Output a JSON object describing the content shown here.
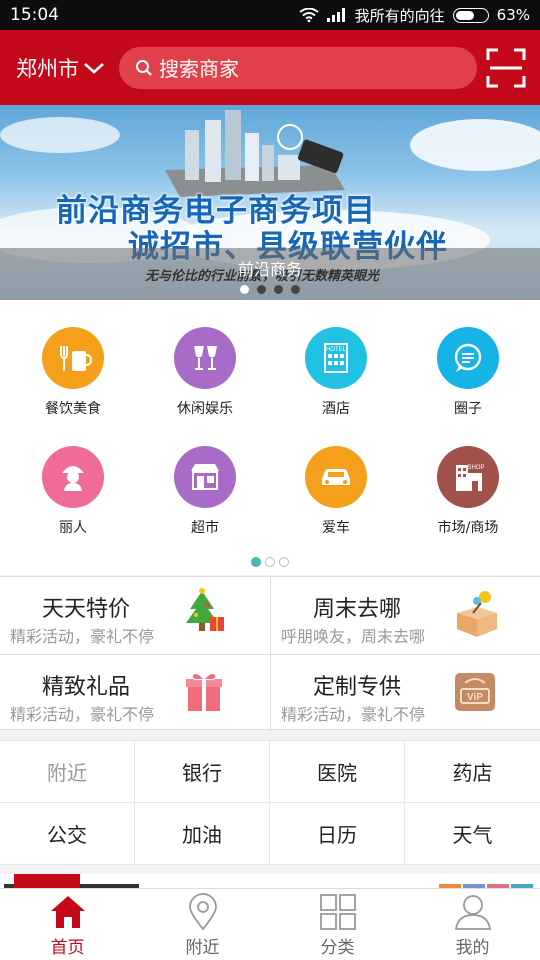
{
  "status_bar": {
    "time": "15:04",
    "carrier": "我所有的向往",
    "battery": "63%",
    "battery_level": 0.63
  },
  "header": {
    "city": "郑州市",
    "search_placeholder": "搜索商家"
  },
  "banner": {
    "headline_1": "前沿商务电子商务项目",
    "headline_2": "诚招市、县级联营伙伴",
    "caption": "前沿商务",
    "subtext": "无与伦比的行业前景，吸引无数精英眼光",
    "slide_count": 4,
    "active_slide": 1
  },
  "categories": [
    {
      "label": "餐饮美食",
      "icon": "food-icon",
      "color": "#f5a01b"
    },
    {
      "label": "休闲娱乐",
      "icon": "wine-glasses-icon",
      "color": "#a96bc8"
    },
    {
      "label": "酒店",
      "icon": "hotel-icon",
      "color": "#21c1e3"
    },
    {
      "label": "圈子",
      "icon": "chat-bubble-icon",
      "color": "#16b3e6"
    },
    {
      "label": "丽人",
      "icon": "beauty-icon",
      "color": "#f06b95"
    },
    {
      "label": "超市",
      "icon": "store-icon",
      "color": "#a96bc8"
    },
    {
      "label": "爱车",
      "icon": "car-icon",
      "color": "#f5a01b"
    },
    {
      "label": "市场/商场",
      "icon": "mall-icon",
      "color": "#a0524a"
    }
  ],
  "category_pages": {
    "count": 3,
    "active": 1
  },
  "promos": [
    {
      "title": "天天特价",
      "subtitle": "精彩活动，豪礼不停",
      "icon": "christmas-tree-icon"
    },
    {
      "title": "周末去哪",
      "subtitle": "呼朋唤友，周末去哪",
      "icon": "gift-box-open-icon"
    },
    {
      "title": "精致礼品",
      "subtitle": "精彩活动，豪礼不停",
      "icon": "gift-icon"
    },
    {
      "title": "定制专供",
      "subtitle": "精彩活动，豪礼不停",
      "icon": "vip-icon"
    }
  ],
  "quick_links": [
    {
      "label": "附近",
      "muted": true
    },
    {
      "label": "银行",
      "muted": false
    },
    {
      "label": "医院",
      "muted": false
    },
    {
      "label": "药店",
      "muted": false
    },
    {
      "label": "公交",
      "muted": false
    },
    {
      "label": "加油",
      "muted": false
    },
    {
      "label": "日历",
      "muted": false
    },
    {
      "label": "天气",
      "muted": false
    }
  ],
  "tabbar": [
    {
      "label": "首页",
      "icon": "home-icon",
      "active": true
    },
    {
      "label": "附近",
      "icon": "location-pin-icon",
      "active": false
    },
    {
      "label": "分类",
      "icon": "grid-icon",
      "active": false
    },
    {
      "label": "我的",
      "icon": "user-icon",
      "active": false
    }
  ],
  "colors": {
    "brand_red": "#c4091a",
    "search_bg": "#e1414b",
    "accent_teal": "#49b7b0"
  }
}
